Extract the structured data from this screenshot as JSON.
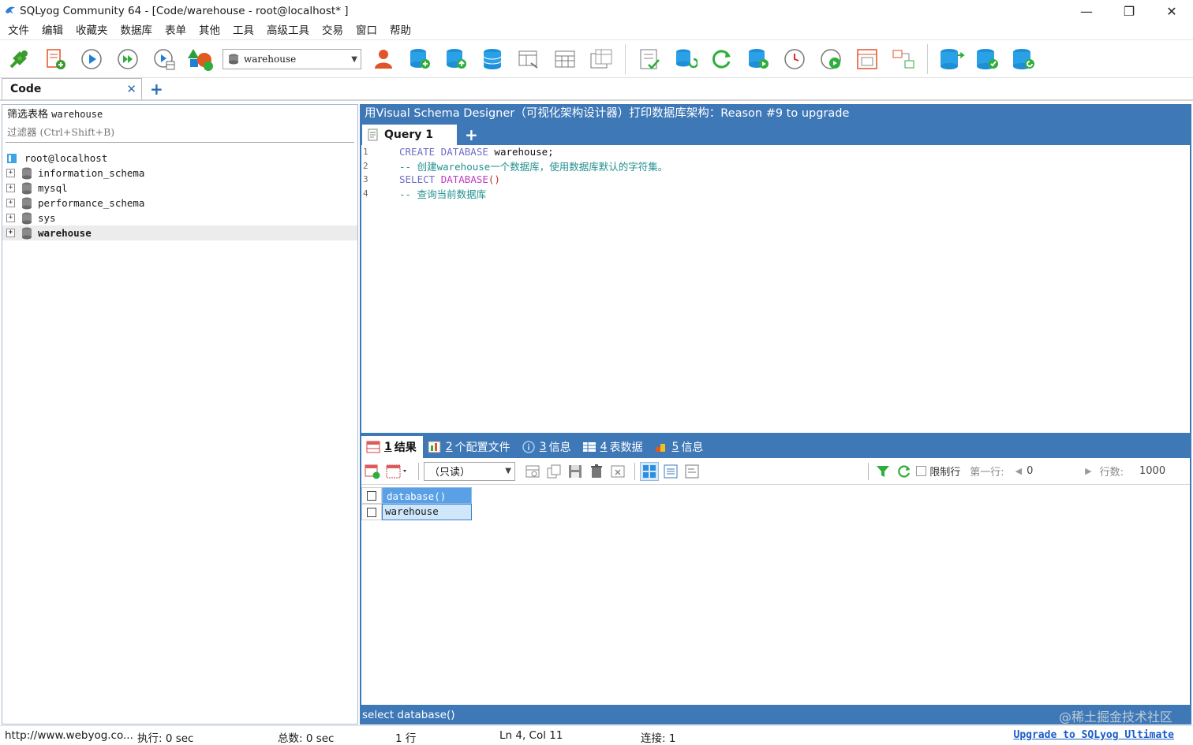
{
  "window": {
    "title": "SQLyog Community 64 - [Code/warehouse - root@localhost* ]",
    "controls": [
      "—",
      "❐",
      "✕"
    ]
  },
  "menu": [
    "文件",
    "编辑",
    "收藏夹",
    "数据库",
    "表单",
    "其他",
    "工具",
    "高级工具",
    "交易",
    "窗口",
    "帮助"
  ],
  "toolbar": {
    "db_selector_value": "warehouse"
  },
  "connection_tab": {
    "label": "Code",
    "close": "✕",
    "add": "+"
  },
  "object_browser": {
    "filter_label": "筛选表格",
    "filter_db": "warehouse",
    "filter_placeholder": "过滤器 (Ctrl+Shift+B)",
    "root": "root@localhost",
    "databases": [
      "information_schema",
      "mysql",
      "performance_schema",
      "sys",
      "warehouse"
    ],
    "selected": "warehouse"
  },
  "banner": "用Visual Schema Designer（可视化架构设计器）打印数据库架构：Reason #9 to upgrade",
  "query_tab": {
    "label": "Query 1",
    "add": "+"
  },
  "editor": {
    "line_numbers": [
      "1",
      "2",
      "3",
      "4"
    ],
    "line1": {
      "kw": "CREATE DATABASE",
      "rest": " warehouse;"
    },
    "line2": {
      "comment": "-- 创建warehouse一个数据库，使用数据库默认的字符集。"
    },
    "line3": {
      "kw": "SELECT",
      "fn": "DATABASE",
      "paren": "()"
    },
    "line4": {
      "comment": "-- 查询当前数据库"
    }
  },
  "result_tabs": [
    {
      "num": "1",
      "label": "结果"
    },
    {
      "num": "2",
      "label": "个配置文件"
    },
    {
      "num": "3",
      "label": "信息"
    },
    {
      "num": "4",
      "label": "表数据"
    },
    {
      "num": "5",
      "label": "信息"
    }
  ],
  "result_toolbar": {
    "mode_select": "（只读）",
    "limit_label": "限制行",
    "first_row_label": "第一行:",
    "first_row_value": "0",
    "rows_label": "行数:",
    "rows_value": "1000"
  },
  "grid": {
    "column": "database()",
    "rows": [
      "warehouse"
    ]
  },
  "sql_footer": "select database()",
  "status": {
    "url": "http://www.webyog.co...",
    "exec": "执行: 0 sec",
    "total": "总数: 0 sec",
    "rows": "1 行",
    "pos": "Ln 4, Col 11",
    "conn": "连接: 1",
    "upgrade": "Upgrade to SQLyog Ultimate"
  },
  "watermark": "@稀土掘金技术社区",
  "colors": {
    "accent_blue": "#3e78b7",
    "grid_header": "#5aa0e6",
    "keyword": "#6e6ec8",
    "function": "#c23cc2",
    "comment": "#239090"
  }
}
